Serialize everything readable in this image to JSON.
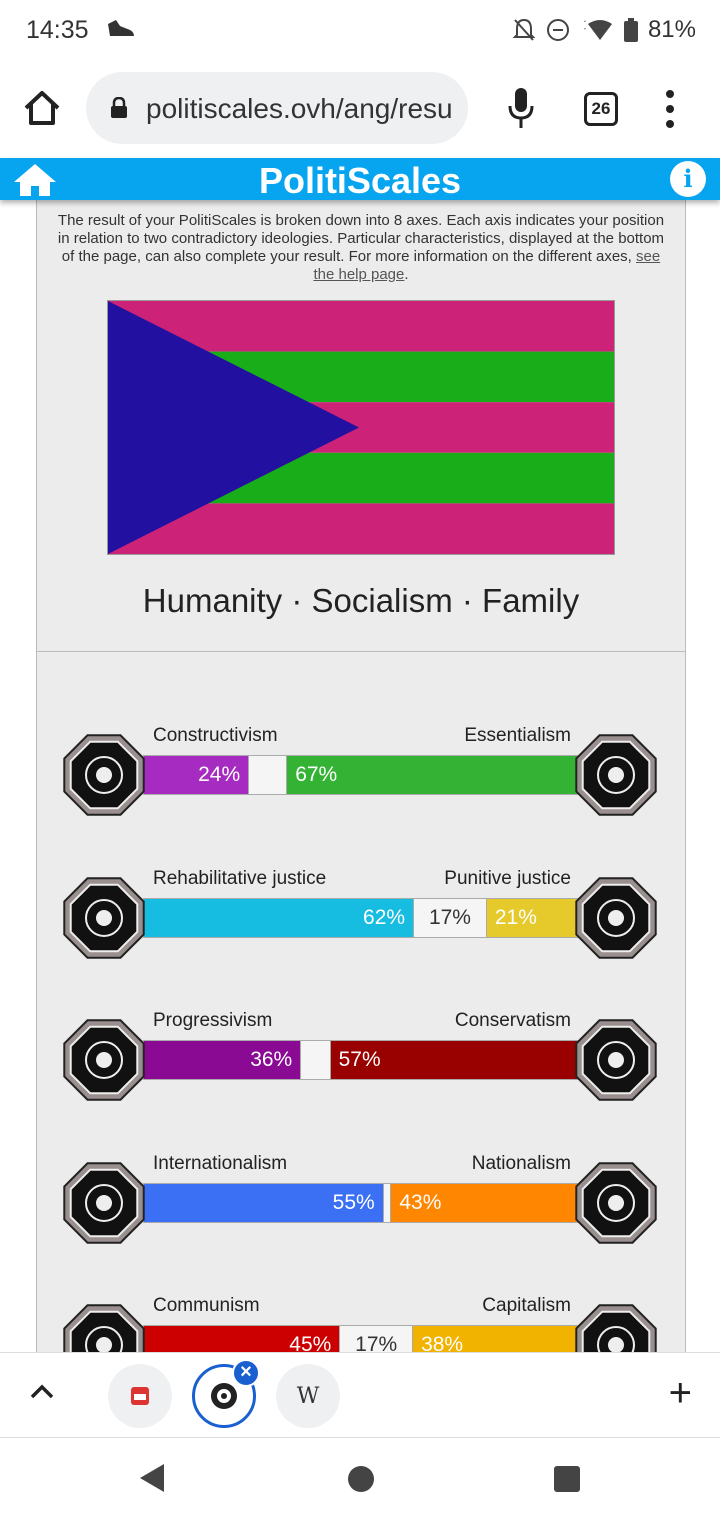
{
  "status_bar": {
    "time": "14:35",
    "battery": "81%",
    "icons": [
      "shoe-icon",
      "bell-off-icon",
      "do-not-disturb-icon",
      "wifi-icon",
      "battery-icon"
    ]
  },
  "browser": {
    "url": "politiscales.ovh/ang/resu",
    "tab_count": "26",
    "icons": [
      "home-icon",
      "lock-icon",
      "mic-icon",
      "tabs-icon",
      "more-vert-icon"
    ]
  },
  "site": {
    "title": "PolitiScales",
    "header_color": "#07a4f0",
    "intro_text": "The result of your PolitiScales is broken down into 8 axes. Each axis indicates your position in relation to two contradictory ideologies. Particular characteristics, displayed at the bottom of the page, can also complete your result. For more information on the different axes, ",
    "help_link": "see the help page",
    "intro_end": ".",
    "flag": {
      "stripe_colors": [
        "#cc2277",
        "#1aad1a",
        "#cc2277",
        "#1aad1a",
        "#cc2277"
      ],
      "triangle_color": "#2211a0"
    },
    "motto": "Humanity · Socialism · Family"
  },
  "axes": [
    {
      "left_label": "Constructivism",
      "right_label": "Essentialism",
      "left_pct": 24,
      "mid_pct": 9,
      "right_pct": 67,
      "left_text": "24%",
      "mid_text": "",
      "right_text": "67%",
      "left_color": "#a62bc0",
      "right_color": "#34b234",
      "left_icon": "eye-icon",
      "right_icon": "flower-icon"
    },
    {
      "left_label": "Rehabilitative justice",
      "right_label": "Punitive justice",
      "left_pct": 62,
      "mid_pct": 17,
      "right_pct": 21,
      "left_text": "62%",
      "mid_text": "17%",
      "right_text": "21%",
      "left_color": "#17bde0",
      "right_color": "#e6c92b",
      "left_icon": "handshake-icon",
      "right_icon": "prison-bars-icon"
    },
    {
      "left_label": "Progressivism",
      "right_label": "Conservatism",
      "left_pct": 36,
      "mid_pct": 7,
      "right_pct": 57,
      "left_text": "36%",
      "mid_text": "",
      "right_text": "57%",
      "left_color": "#8a0a94",
      "right_color": "#990000",
      "left_icon": "rocket-icon",
      "right_icon": "fountain-pen-icon"
    },
    {
      "left_label": "Internationalism",
      "right_label": "Nationalism",
      "left_pct": 55,
      "mid_pct": 2,
      "right_pct": 43,
      "left_text": "55%",
      "mid_text": "",
      "right_text": "43%",
      "left_color": "#3b70f5",
      "right_color": "#ff8600",
      "left_icon": "globe-icon",
      "right_icon": "flag-icon"
    },
    {
      "left_label": "Communism",
      "right_label": "Capitalism",
      "left_pct": 45,
      "mid_pct": 17,
      "right_pct": 38,
      "left_text": "45%",
      "mid_text": "17%",
      "right_text": "38%",
      "left_color": "#cc0000",
      "right_color": "#f2b200",
      "left_icon": "hammer-sickle-icon",
      "right_icon": "money-bag-icon"
    }
  ],
  "tab_strip": {
    "tabs": [
      "tab-icon-1",
      "tab-icon-politiscales",
      "W"
    ],
    "close_label": "×",
    "new_tab_label": "+"
  }
}
